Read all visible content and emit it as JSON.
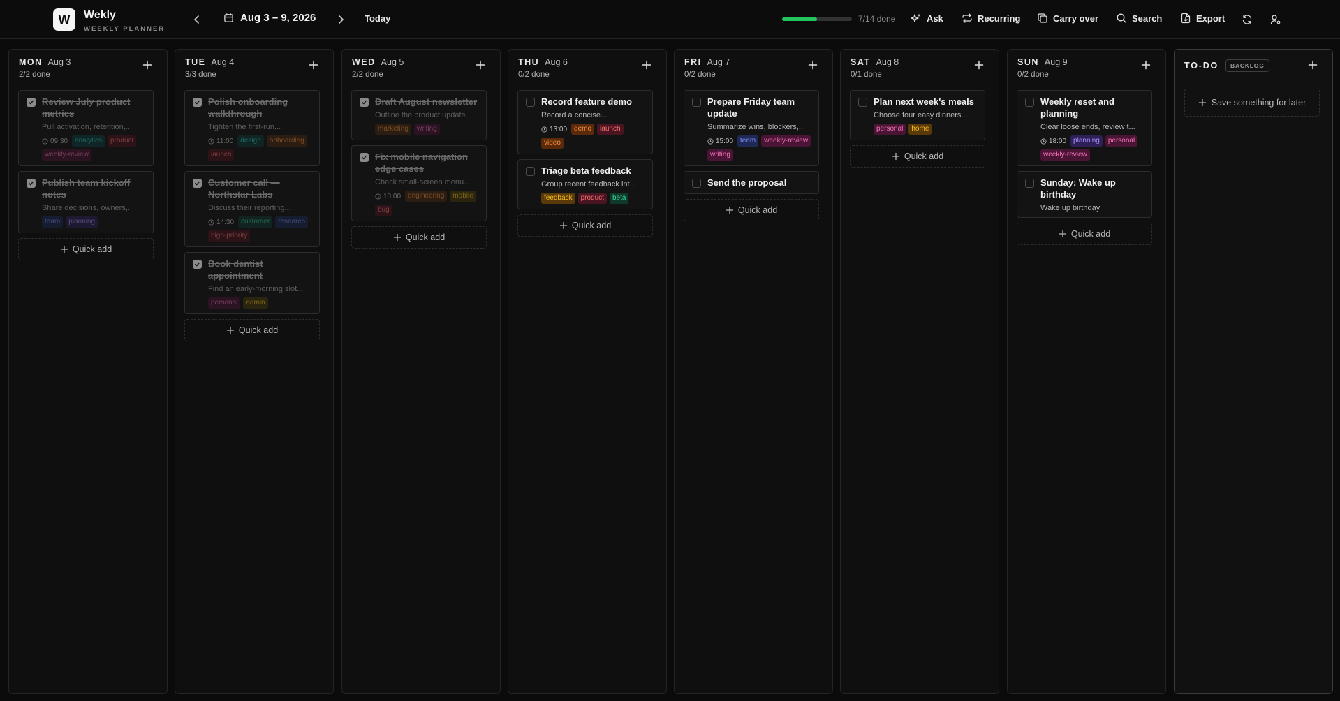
{
  "app": {
    "logo_letter": "W",
    "name": "Wekly",
    "subtitle": "WEEKLY PLANNER"
  },
  "header": {
    "date_range": "Aug 3 – 9, 2026",
    "today_label": "Today",
    "progress_fraction": 0.5,
    "progress_text": "7/14 done",
    "tools": {
      "ask": "Ask",
      "recurring": "Recurring",
      "carry_over": "Carry over",
      "search": "Search",
      "export": "Export"
    }
  },
  "tag_colors": {
    "analytics": [
      "#0e3b3c",
      "#2dd4bf"
    ],
    "product": [
      "#4a1420",
      "#f87171"
    ],
    "weekly-review": [
      "#4a1535",
      "#f472b6"
    ],
    "team": [
      "#1e2a55",
      "#818cf8"
    ],
    "planning": [
      "#2e1f57",
      "#a78bfa"
    ],
    "design": [
      "#0f3a3a",
      "#2dd4bf"
    ],
    "onboarding": [
      "#4a2a10",
      "#fb923c"
    ],
    "launch": [
      "#4a1420",
      "#f87171"
    ],
    "customer": [
      "#0f3a36",
      "#34d399"
    ],
    "research": [
      "#1e2a55",
      "#818cf8"
    ],
    "high-priority": [
      "#4a1420",
      "#f87171"
    ],
    "personal": [
      "#4a1535",
      "#f472b6"
    ],
    "admin": [
      "#4a3a0a",
      "#facc15"
    ],
    "marketing": [
      "#4a2a10",
      "#fb923c"
    ],
    "writing": [
      "#4a1535",
      "#f472b6"
    ],
    "engineering": [
      "#4a2a10",
      "#fb923c"
    ],
    "mobile": [
      "#4a3a0a",
      "#facc15"
    ],
    "bug": [
      "#4a1420",
      "#f87171"
    ],
    "demo": [
      "#5a2a0a",
      "#fb923c"
    ],
    "video": [
      "#5a2a0a",
      "#fb923c"
    ],
    "feedback": [
      "#5a3a08",
      "#fbbf24"
    ],
    "beta": [
      "#0f3a2a",
      "#34d399"
    ],
    "home": [
      "#5a3a08",
      "#fbbf24"
    ]
  },
  "quick_add_label": "Quick add",
  "days": [
    {
      "dow": "MON",
      "date": "Aug 3",
      "done": "2/2 done",
      "tasks": [
        {
          "title": "Review July product metrics",
          "desc": "Pull activation, retention,...",
          "time": "09:30",
          "tags": [
            "analytics",
            "product",
            "weekly-review"
          ],
          "done": true
        },
        {
          "title": "Publish team kickoff notes",
          "desc": "Share decisions, owners,...",
          "time": "",
          "tags": [
            "team",
            "planning"
          ],
          "done": true
        }
      ]
    },
    {
      "dow": "TUE",
      "date": "Aug 4",
      "done": "3/3 done",
      "tasks": [
        {
          "title": "Polish onboarding walkthrough",
          "desc": "Tighten the first-run...",
          "time": "11:00",
          "tags": [
            "design",
            "onboarding",
            "launch"
          ],
          "done": true
        },
        {
          "title": "Customer call — Northstar Labs",
          "desc": "Discuss their reporting...",
          "time": "14:30",
          "tags": [
            "customer",
            "research",
            "high-priority"
          ],
          "done": true
        },
        {
          "title": "Book dentist appointment",
          "desc": "Find an early-morning slot...",
          "time": "",
          "tags": [
            "personal",
            "admin"
          ],
          "done": true
        }
      ]
    },
    {
      "dow": "WED",
      "date": "Aug 5",
      "done": "2/2 done",
      "tasks": [
        {
          "title": "Draft August newsletter",
          "desc": "Outline the product update...",
          "time": "",
          "tags": [
            "marketing",
            "writing"
          ],
          "done": true
        },
        {
          "title": "Fix mobile navigation edge cases",
          "desc": "Check small-screen menu...",
          "time": "10:00",
          "tags": [
            "engineering",
            "mobile",
            "bug"
          ],
          "done": true
        }
      ]
    },
    {
      "dow": "THU",
      "date": "Aug 6",
      "done": "0/2 done",
      "tasks": [
        {
          "title": "Record feature demo",
          "desc": "Record a concise...",
          "time": "13:00",
          "tags": [
            "demo",
            "launch",
            "video"
          ],
          "done": false
        },
        {
          "title": "Triage beta feedback",
          "desc": "Group recent feedback int...",
          "time": "",
          "tags": [
            "feedback",
            "product",
            "beta"
          ],
          "done": false
        }
      ]
    },
    {
      "dow": "FRI",
      "date": "Aug 7",
      "done": "0/2 done",
      "tasks": [
        {
          "title": "Prepare Friday team update",
          "desc": "Summarize wins, blockers,...",
          "time": "15:00",
          "tags": [
            "team",
            "weekly-review",
            "writing"
          ],
          "done": false
        },
        {
          "title": "Send the proposal",
          "desc": "",
          "time": "",
          "tags": [],
          "done": false
        }
      ]
    },
    {
      "dow": "SAT",
      "date": "Aug 8",
      "done": "0/1 done",
      "tasks": [
        {
          "title": "Plan next week's meals",
          "desc": "Choose four easy dinners...",
          "time": "",
          "tags": [
            "personal",
            "home"
          ],
          "done": false
        }
      ]
    },
    {
      "dow": "SUN",
      "date": "Aug 9",
      "done": "0/2 done",
      "tasks": [
        {
          "title": "Weekly reset and planning",
          "desc": "Clear loose ends, review t...",
          "time": "18:00",
          "tags": [
            "planning",
            "personal",
            "weekly-review"
          ],
          "done": false
        },
        {
          "title": "Sunday: Wake up birthday",
          "desc": "Wake up birthday",
          "time": "",
          "tags": [],
          "done": false
        }
      ]
    }
  ],
  "todo": {
    "title": "TO-DO",
    "badge": "BACKLOG",
    "save_label": "Save something for later"
  }
}
